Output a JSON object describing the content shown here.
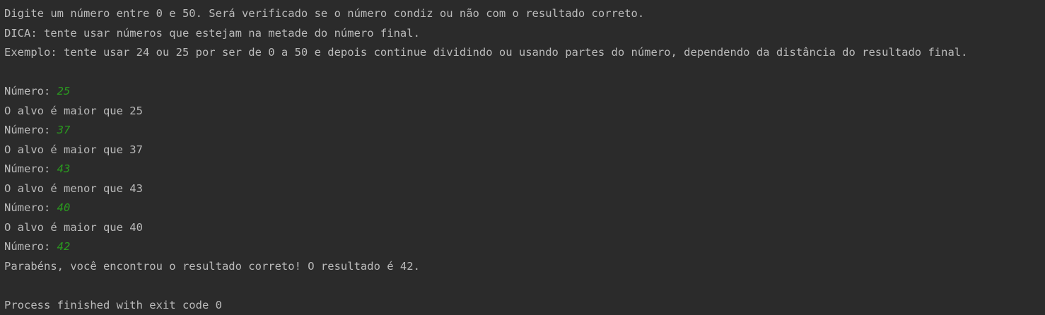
{
  "colors": {
    "background": "#2b2b2b",
    "text": "#bbbbbb",
    "user_input": "#2a9b1f"
  },
  "console": {
    "lines": [
      {
        "text": "Digite um número entre 0 e 50. Será verificado se o número condiz ou não com o resultado correto."
      },
      {
        "text": "DICA: tente usar números que estejam na metade do número final."
      },
      {
        "text": "Exemplo: tente usar 24 ou 25 por ser de 0 a 50 e depois continue dividindo ou usando partes do número, dependendo da distância do resultado final."
      },
      {
        "text": ""
      },
      {
        "text": "Número: ",
        "input": "25"
      },
      {
        "text": "O alvo é maior que 25"
      },
      {
        "text": "Número: ",
        "input": "37"
      },
      {
        "text": "O alvo é maior que 37"
      },
      {
        "text": "Número: ",
        "input": "43"
      },
      {
        "text": "O alvo é menor que 43"
      },
      {
        "text": "Número: ",
        "input": "40"
      },
      {
        "text": "O alvo é maior que 40"
      },
      {
        "text": "Número: ",
        "input": "42"
      },
      {
        "text": "Parabéns, você encontrou o resultado correto! O resultado é 42."
      },
      {
        "text": ""
      },
      {
        "text": "Process finished with exit code 0"
      }
    ]
  }
}
